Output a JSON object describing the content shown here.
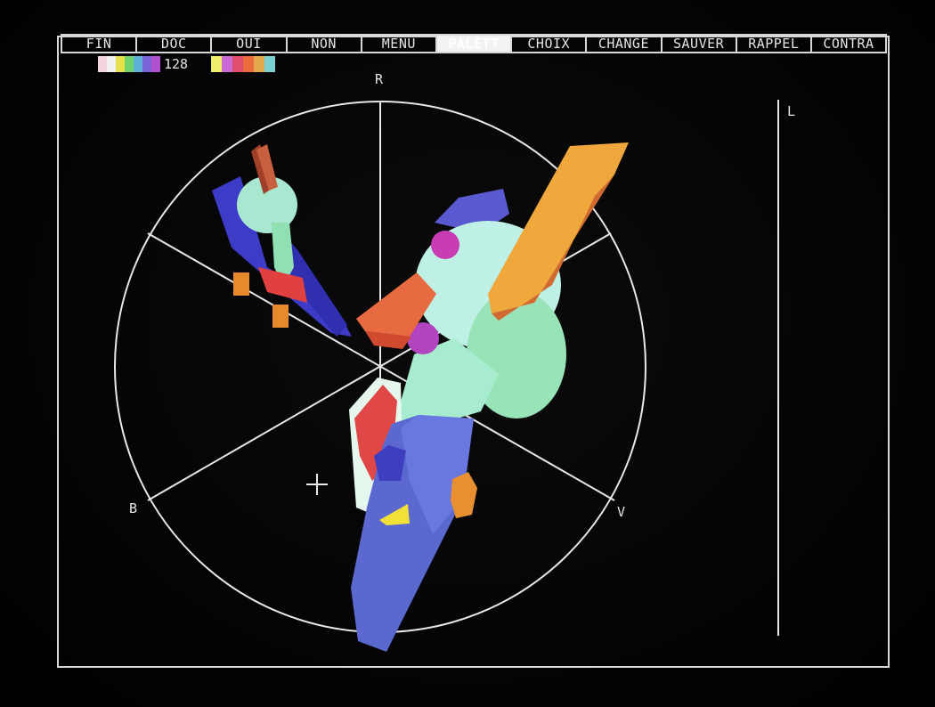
{
  "menu": {
    "items": [
      {
        "label": "FIN",
        "active": false
      },
      {
        "label": "DOC",
        "active": false
      },
      {
        "label": "OUI",
        "active": false
      },
      {
        "label": "NON",
        "active": false
      },
      {
        "label": "MENU",
        "active": false
      },
      {
        "label": "PALETT",
        "active": true
      },
      {
        "label": "CHOIX",
        "active": false
      },
      {
        "label": "CHANGE",
        "active": false
      },
      {
        "label": "SAUVER",
        "active": false
      },
      {
        "label": "RAPPEL",
        "active": false
      },
      {
        "label": "CONTRA",
        "active": false
      }
    ]
  },
  "palette": {
    "count": "128",
    "primary_colors": [
      "#f3d4dc",
      "#f0f0f0",
      "#e8e04a",
      "#6fd36a",
      "#5ab0d6",
      "#7a62d8",
      "#b24fd0"
    ],
    "secondary_colors": [
      "#f0ee6a",
      "#c96ad4",
      "#e04e6e",
      "#e96d3a",
      "#e3a84a",
      "#7ad0d0"
    ]
  },
  "color_wheel": {
    "labels": {
      "top": "R",
      "left": "B",
      "right": "V",
      "scale": "L"
    }
  },
  "colors": {
    "line": "#e8e8e8",
    "background": "#050505",
    "menu_active": "#f2f2f2"
  }
}
